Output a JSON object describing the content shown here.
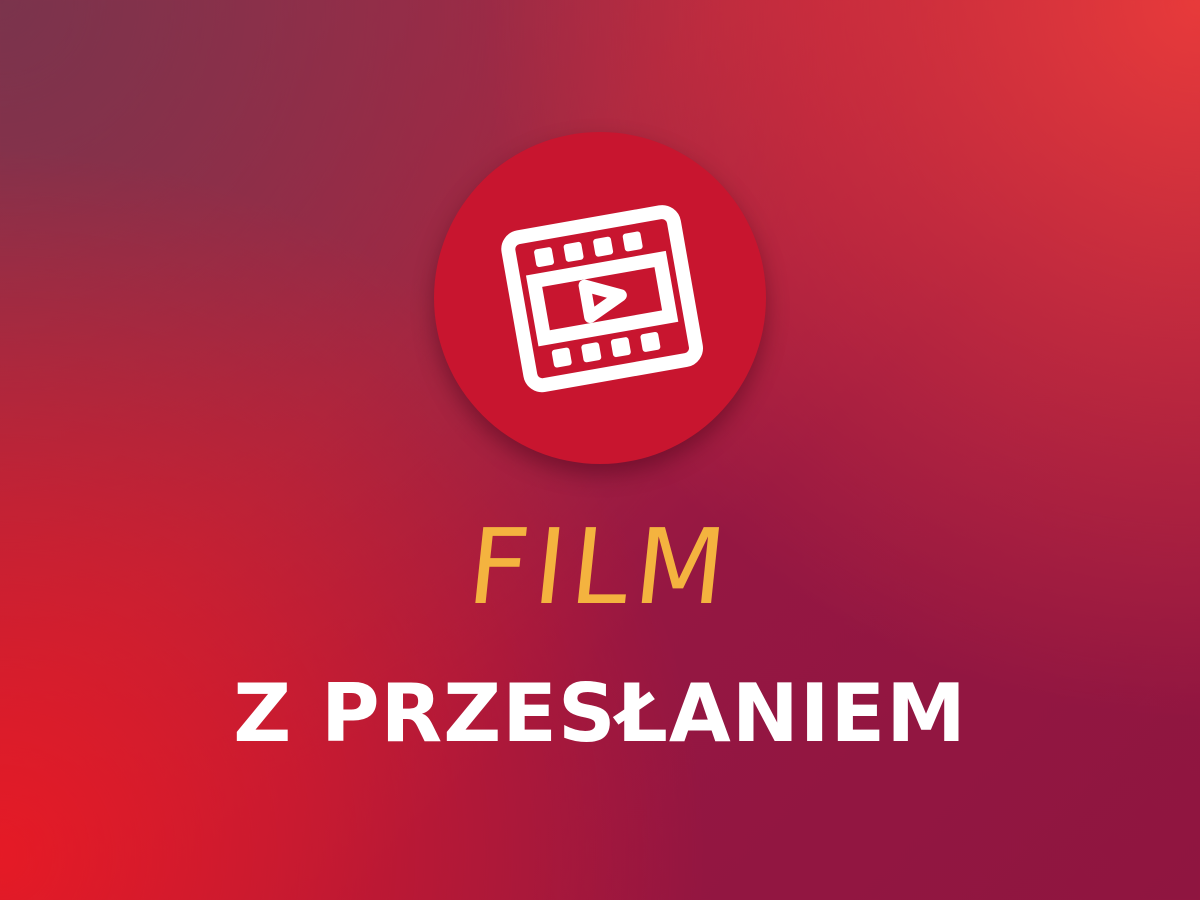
{
  "icon": {
    "name": "film-play-icon",
    "badge_color": "#c8152f",
    "icon_color": "#ffffff"
  },
  "text": {
    "title": "FILM",
    "subtitle": "Z PRZESŁANIEM"
  },
  "colors": {
    "title": "#f4b33f",
    "subtitle": "#ffffff"
  }
}
